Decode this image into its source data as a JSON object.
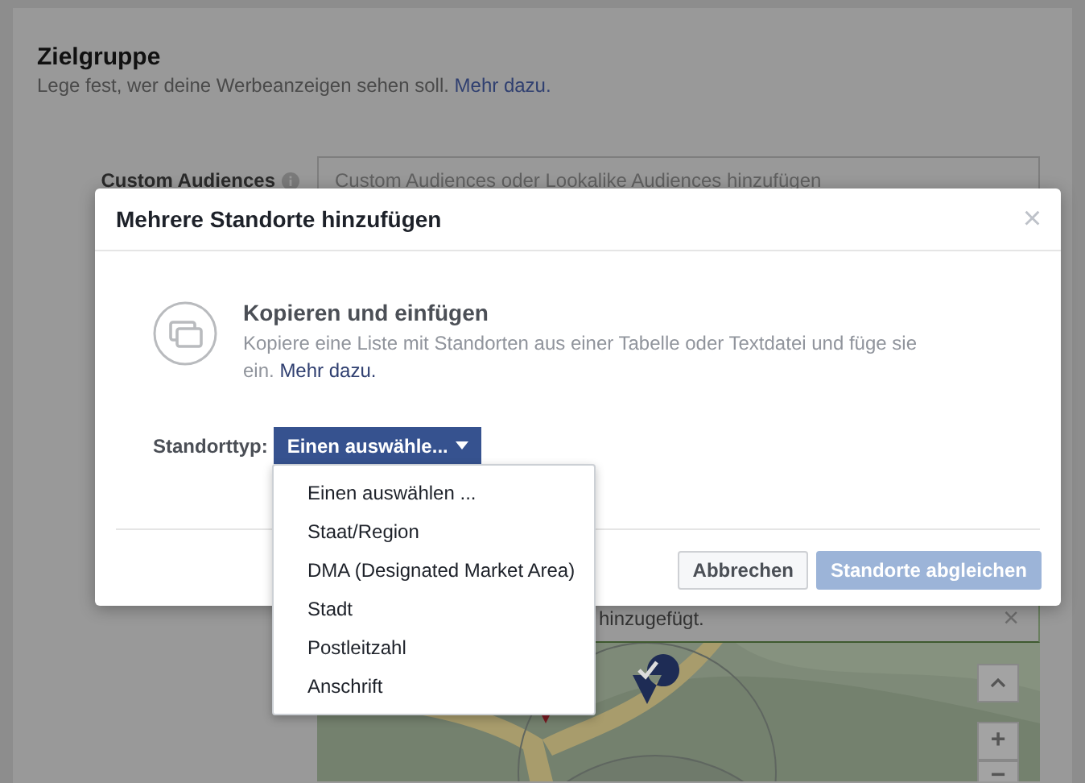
{
  "page": {
    "section_title": "Zielgruppe",
    "description": "Lege fest, wer deine Werbeanzeigen sehen soll. ",
    "description_link": "Mehr dazu.",
    "custom_audiences": {
      "label": "Custom Audiences",
      "placeholder": "Custom Audiences oder Lookalike Audiences hinzufügen"
    },
    "notice": {
      "text": "hinzugefügt.",
      "close": "×"
    },
    "map": {
      "kind": "picture",
      "zoom_in": "+",
      "zoom_out": "−"
    }
  },
  "dialog": {
    "title": "Mehrere Standorte hinzufügen",
    "close": "×",
    "option": {
      "title": "Kopieren und einfügen",
      "description": "Kopiere eine Liste mit Standorten aus einer Tabelle oder Textdatei und füge sie ein. ",
      "link": "Mehr dazu."
    },
    "location_type": {
      "label": "Standorttyp:",
      "value": "Einen auswähle...",
      "expanded": true,
      "options": [
        "Einen auswählen ...",
        "Staat/Region",
        "DMA (Designated Market Area)",
        "Stadt",
        "Postleitzahl",
        "Anschrift"
      ]
    },
    "buttons": [
      {
        "label": "Abbrechen",
        "kind": "secondary",
        "disabled": false
      },
      {
        "label": "Standorte abgleichen",
        "kind": "primary",
        "disabled": true
      }
    ]
  }
}
